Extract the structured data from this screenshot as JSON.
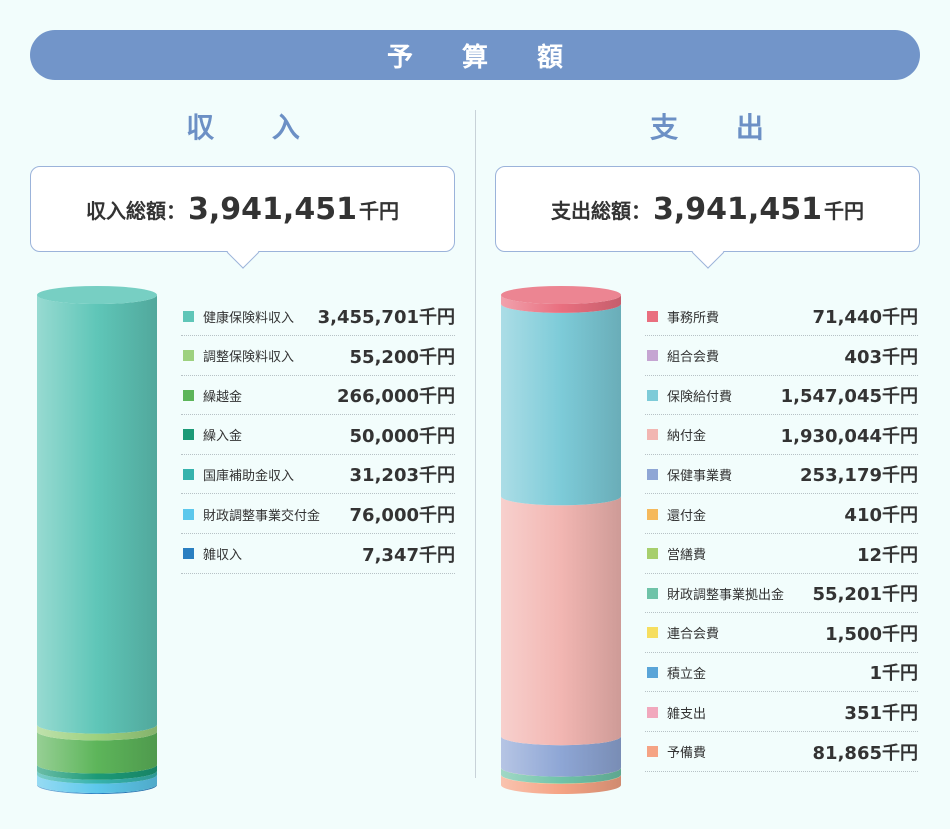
{
  "title": "予 算 額",
  "income": {
    "heading": "収 入",
    "total_label": "収入総額：",
    "total_value": "3,941,451",
    "total_unit": "千円"
  },
  "expense": {
    "heading": "支 出",
    "total_label": "支出総額：",
    "total_value": "3,941,451",
    "total_unit": "千円"
  },
  "chart_data": [
    {
      "type": "bar",
      "stacked": true,
      "unit": "千円",
      "categories": [
        "健康保険料収入",
        "調整保険料収入",
        "繰越金",
        "繰入金",
        "国庫補助金収入",
        "財政調整事業交付金",
        "雑収入"
      ],
      "values": [
        3455701,
        55200,
        266000,
        50000,
        31203,
        76000,
        7347
      ],
      "labels": [
        "3,455,701千円",
        "55,200千円",
        "266,000千円",
        "50,000千円",
        "31,203千円",
        "76,000千円",
        "7,347千円"
      ],
      "colors": [
        "#5fc6b8",
        "#9dd17f",
        "#5db55a",
        "#1c9a77",
        "#36b3ad",
        "#5dc8ec",
        "#2a7fc1"
      ]
    },
    {
      "type": "bar",
      "stacked": true,
      "unit": "千円",
      "categories": [
        "事務所費",
        "組合会費",
        "保険給付費",
        "納付金",
        "保健事業費",
        "還付金",
        "営繕費",
        "財政調整事業拠出金",
        "連合会費",
        "積立金",
        "雑支出",
        "予備費"
      ],
      "values": [
        71440,
        403,
        1547045,
        1930044,
        253179,
        410,
        12,
        55201,
        1500,
        1,
        351,
        81865
      ],
      "labels": [
        "71,440千円",
        "403千円",
        "1,547,045千円",
        "1,930,044千円",
        "253,179千円",
        "410千円",
        "12千円",
        "55,201千円",
        "1,500千円",
        "1千円",
        "351千円",
        "81,865千円"
      ],
      "colors": [
        "#e96f7f",
        "#c5a5d2",
        "#7dcbd8",
        "#f2b6b2",
        "#8ea6d5",
        "#f5b95c",
        "#a7cf6d",
        "#6fc3a8",
        "#f6de5f",
        "#5aa5d8",
        "#f1a8bd",
        "#f5a384"
      ]
    }
  ]
}
